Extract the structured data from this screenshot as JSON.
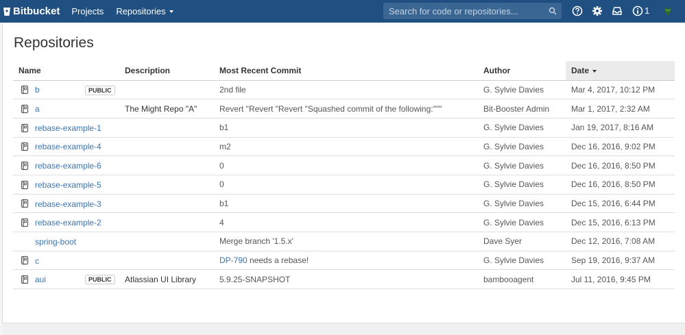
{
  "header": {
    "brand": "Bitbucket",
    "nav": {
      "projects": "Projects",
      "repositories": "Repositories"
    },
    "search_placeholder": "Search for code or repositories...",
    "notification_count": "1"
  },
  "page": {
    "title": "Repositories"
  },
  "table": {
    "columns": {
      "name": "Name",
      "description": "Description",
      "commit": "Most Recent Commit",
      "author": "Author",
      "date": "Date"
    },
    "rows": [
      {
        "name": "b",
        "public": "PUBLIC",
        "description": "",
        "commit": "2nd file",
        "author": "G. Sylvie Davies",
        "date": "Mar 4, 2017, 10:12 PM"
      },
      {
        "name": "a",
        "public": "",
        "description": "The Might Repo \"A\"",
        "commit": "Revert \"Revert \"Revert \"Squashed commit of the following:\"\"\"",
        "author": "Bit-Booster Admin",
        "date": "Mar 1, 2017, 2:32 AM"
      },
      {
        "name": "rebase-example-1",
        "public": "",
        "description": "",
        "commit": "b1",
        "author": "G. Sylvie Davies",
        "date": "Jan 19, 2017, 8:16 AM"
      },
      {
        "name": "rebase-example-4",
        "public": "",
        "description": "",
        "commit": "m2",
        "author": "G. Sylvie Davies",
        "date": "Dec 16, 2016, 9:02 PM"
      },
      {
        "name": "rebase-example-6",
        "public": "",
        "description": "",
        "commit": "0",
        "author": "G. Sylvie Davies",
        "date": "Dec 16, 2016, 8:50 PM"
      },
      {
        "name": "rebase-example-5",
        "public": "",
        "description": "",
        "commit": "0",
        "author": "G. Sylvie Davies",
        "date": "Dec 16, 2016, 8:50 PM"
      },
      {
        "name": "rebase-example-3",
        "public": "",
        "description": "",
        "commit": "b1",
        "author": "G. Sylvie Davies",
        "date": "Dec 15, 2016, 6:44 PM"
      },
      {
        "name": "rebase-example-2",
        "public": "",
        "description": "",
        "commit": "4",
        "author": "G. Sylvie Davies",
        "date": "Dec 15, 2016, 6:13 PM"
      },
      {
        "name": "spring-boot",
        "public": "",
        "description": "",
        "commit": "Merge branch '1.5.x'",
        "author": "Dave Syer",
        "date": "Dec 12, 2016, 7:08 AM",
        "no_icon": true
      },
      {
        "name": "c",
        "public": "",
        "description": "",
        "commit_link": "DP-790",
        "commit": " needs a rebase!",
        "author": "G. Sylvie Davies",
        "date": "Sep 19, 2016, 9:37 AM"
      },
      {
        "name": "aui",
        "public": "PUBLIC",
        "description": "Atlassian UI Library",
        "commit": "5.9.25-SNAPSHOT",
        "author": "bambooagent",
        "date": "Jul 11, 2016, 9:45 PM"
      }
    ]
  },
  "colors": {
    "header_bg": "#205081",
    "link": "#3b73af"
  }
}
